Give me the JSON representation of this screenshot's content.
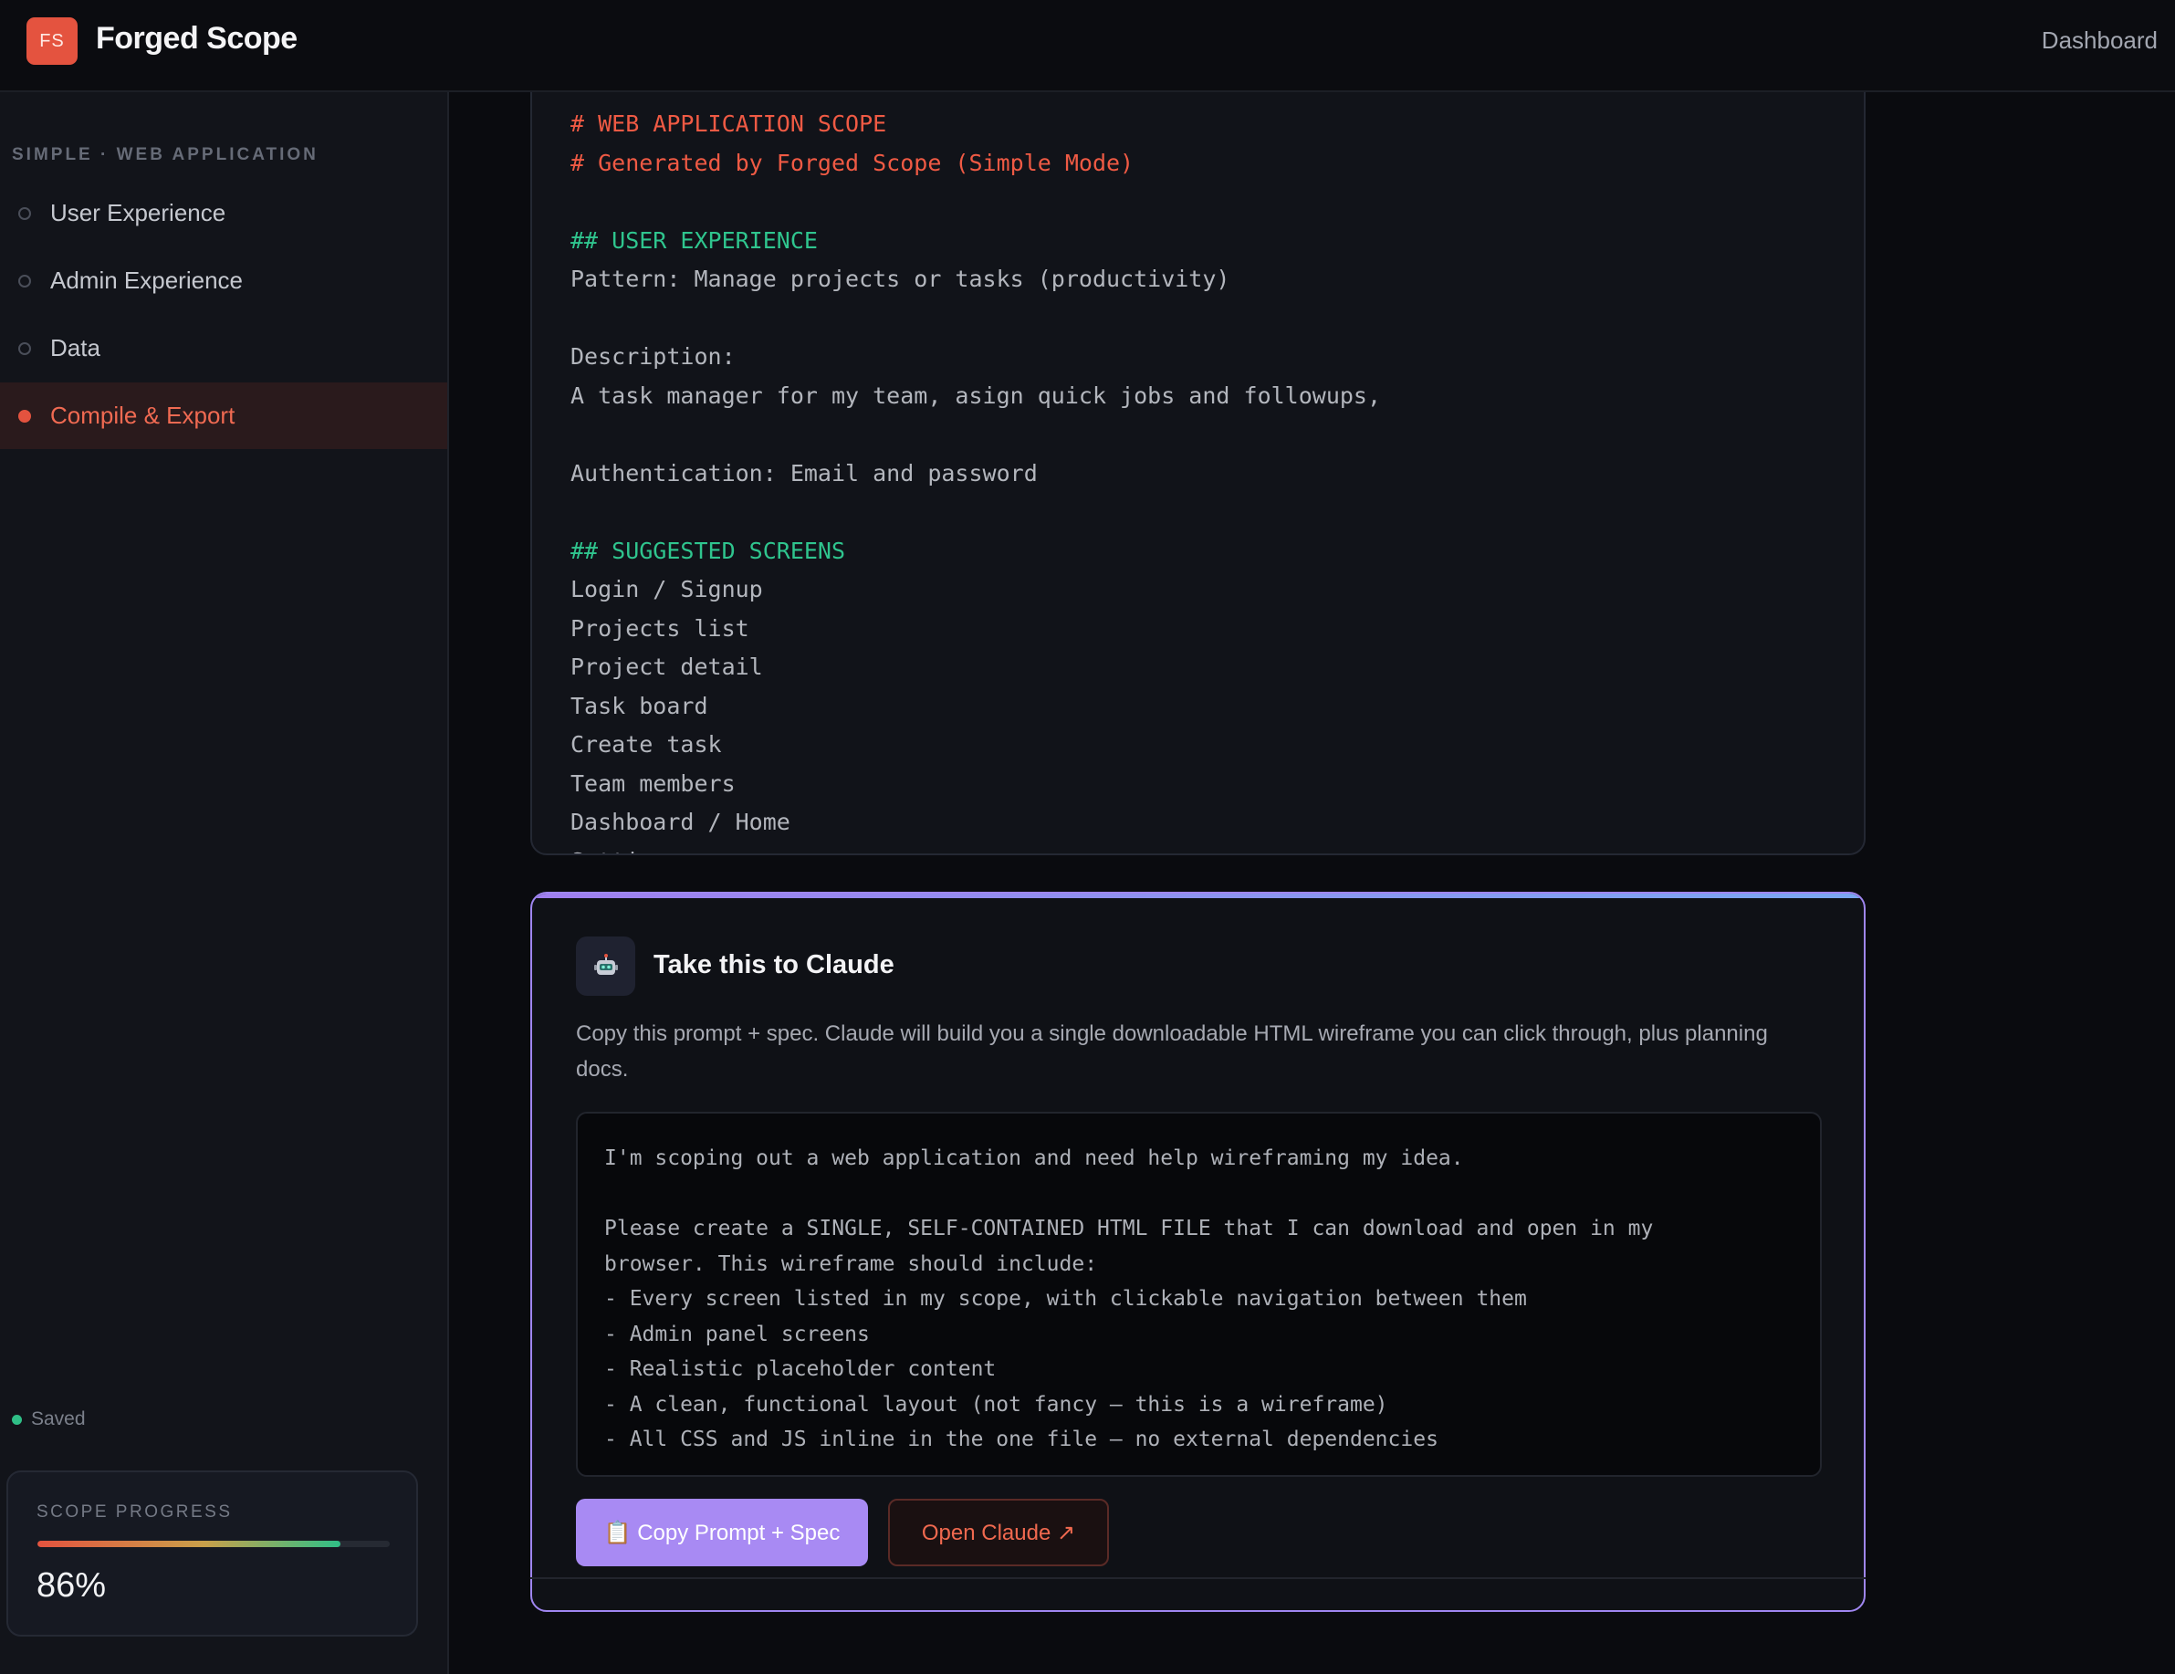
{
  "app": {
    "logo_initials": "FS",
    "title": "Forged Scope",
    "nav_dashboard": "Dashboard"
  },
  "sidebar": {
    "heading": "SIMPLE · WEB APPLICATION",
    "items": [
      {
        "label": "User Experience",
        "active": false
      },
      {
        "label": "Admin Experience",
        "active": false
      },
      {
        "label": "Data",
        "active": false
      },
      {
        "label": "Compile & Export",
        "active": true
      }
    ],
    "saved_label": "Saved",
    "progress": {
      "title": "SCOPE PROGRESS",
      "value_text": "86%",
      "value": 0.86
    }
  },
  "spec": {
    "lines": [
      {
        "text": "# WEB APPLICATION SCOPE",
        "style": "h1"
      },
      {
        "text": "# Generated by Forged Scope (Simple Mode)",
        "style": "h1"
      },
      {
        "text": "",
        "style": "p"
      },
      {
        "text": "## USER EXPERIENCE",
        "style": "h2"
      },
      {
        "text": "Pattern: Manage projects or tasks (productivity)",
        "style": "p"
      },
      {
        "text": "",
        "style": "p"
      },
      {
        "text": "Description:",
        "style": "p"
      },
      {
        "text": "A task manager for my team, asign quick jobs and followups,",
        "style": "p"
      },
      {
        "text": "",
        "style": "p"
      },
      {
        "text": "Authentication: Email and password",
        "style": "p"
      },
      {
        "text": "",
        "style": "p"
      },
      {
        "text": "## SUGGESTED SCREENS",
        "style": "h2"
      },
      {
        "text": "Login / Signup",
        "style": "p"
      },
      {
        "text": "Projects list",
        "style": "p"
      },
      {
        "text": "Project detail",
        "style": "p"
      },
      {
        "text": "Task board",
        "style": "p"
      },
      {
        "text": "Create task",
        "style": "p"
      },
      {
        "text": "Team members",
        "style": "p"
      },
      {
        "text": "Dashboard / Home",
        "style": "p"
      },
      {
        "text": "Settings",
        "style": "p"
      }
    ]
  },
  "claude": {
    "icon": "robot-icon",
    "title": "Take this to Claude",
    "description": "Copy this prompt + spec. Claude will build you a single downloadable HTML wireframe you can click through, plus planning docs.",
    "prompt_lines": [
      "I'm scoping out a web application and need help wireframing my idea.",
      "",
      "Please create a SINGLE, SELF-CONTAINED HTML FILE that I can download and open in my",
      "browser. This wireframe should include:",
      "- Every screen listed in my scope, with clickable navigation between them",
      "- Admin panel screens",
      "- Realistic placeholder content",
      "- A clean, functional layout (not fancy — this is a wireframe)",
      "- All CSS and JS inline in the one file — no external dependencies"
    ],
    "copy_button": "📋 Copy Prompt + Spec",
    "open_button": "Open Claude ↗"
  },
  "colors": {
    "accent": "#e4533f",
    "success": "#2fbf87",
    "purple": "#a88af3"
  }
}
